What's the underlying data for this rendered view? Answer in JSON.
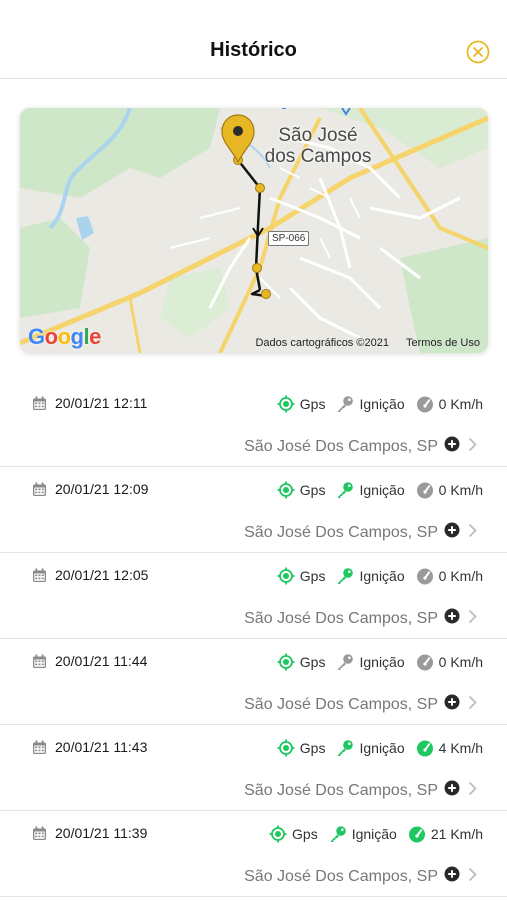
{
  "header": {
    "title": "Histórico"
  },
  "colors": {
    "accent": "#e8b824",
    "active": "#1ec760",
    "inactive": "#9a9a9a"
  },
  "map": {
    "city_line1": "São José",
    "city_line2": "dos Campos",
    "road_shield": "SP-066",
    "logo": "Google",
    "attribution": "Dados cartográficos ©2021",
    "terms": "Termos de Uso"
  },
  "rows": [
    {
      "datetime": "20/01/21 12:11",
      "gps": "Gps",
      "ignition": "Ignição",
      "ignition_on": false,
      "speed": "0 Km/h",
      "moving": false,
      "address": "São José Dos Campos, SP"
    },
    {
      "datetime": "20/01/21 12:09",
      "gps": "Gps",
      "ignition": "Ignição",
      "ignition_on": true,
      "speed": "0 Km/h",
      "moving": false,
      "address": "São José Dos Campos, SP"
    },
    {
      "datetime": "20/01/21 12:05",
      "gps": "Gps",
      "ignition": "Ignição",
      "ignition_on": true,
      "speed": "0 Km/h",
      "moving": false,
      "address": "São José Dos Campos, SP"
    },
    {
      "datetime": "20/01/21 11:44",
      "gps": "Gps",
      "ignition": "Ignição",
      "ignition_on": false,
      "speed": "0 Km/h",
      "moving": false,
      "address": "São José Dos Campos, SP"
    },
    {
      "datetime": "20/01/21 11:43",
      "gps": "Gps",
      "ignition": "Ignição",
      "ignition_on": true,
      "speed": "4 Km/h",
      "moving": true,
      "address": "São José Dos Campos, SP"
    },
    {
      "datetime": "20/01/21 11:39",
      "gps": "Gps",
      "ignition": "Ignição",
      "ignition_on": true,
      "speed": "21 Km/h",
      "moving": true,
      "address": "São José Dos Campos, SP"
    }
  ]
}
